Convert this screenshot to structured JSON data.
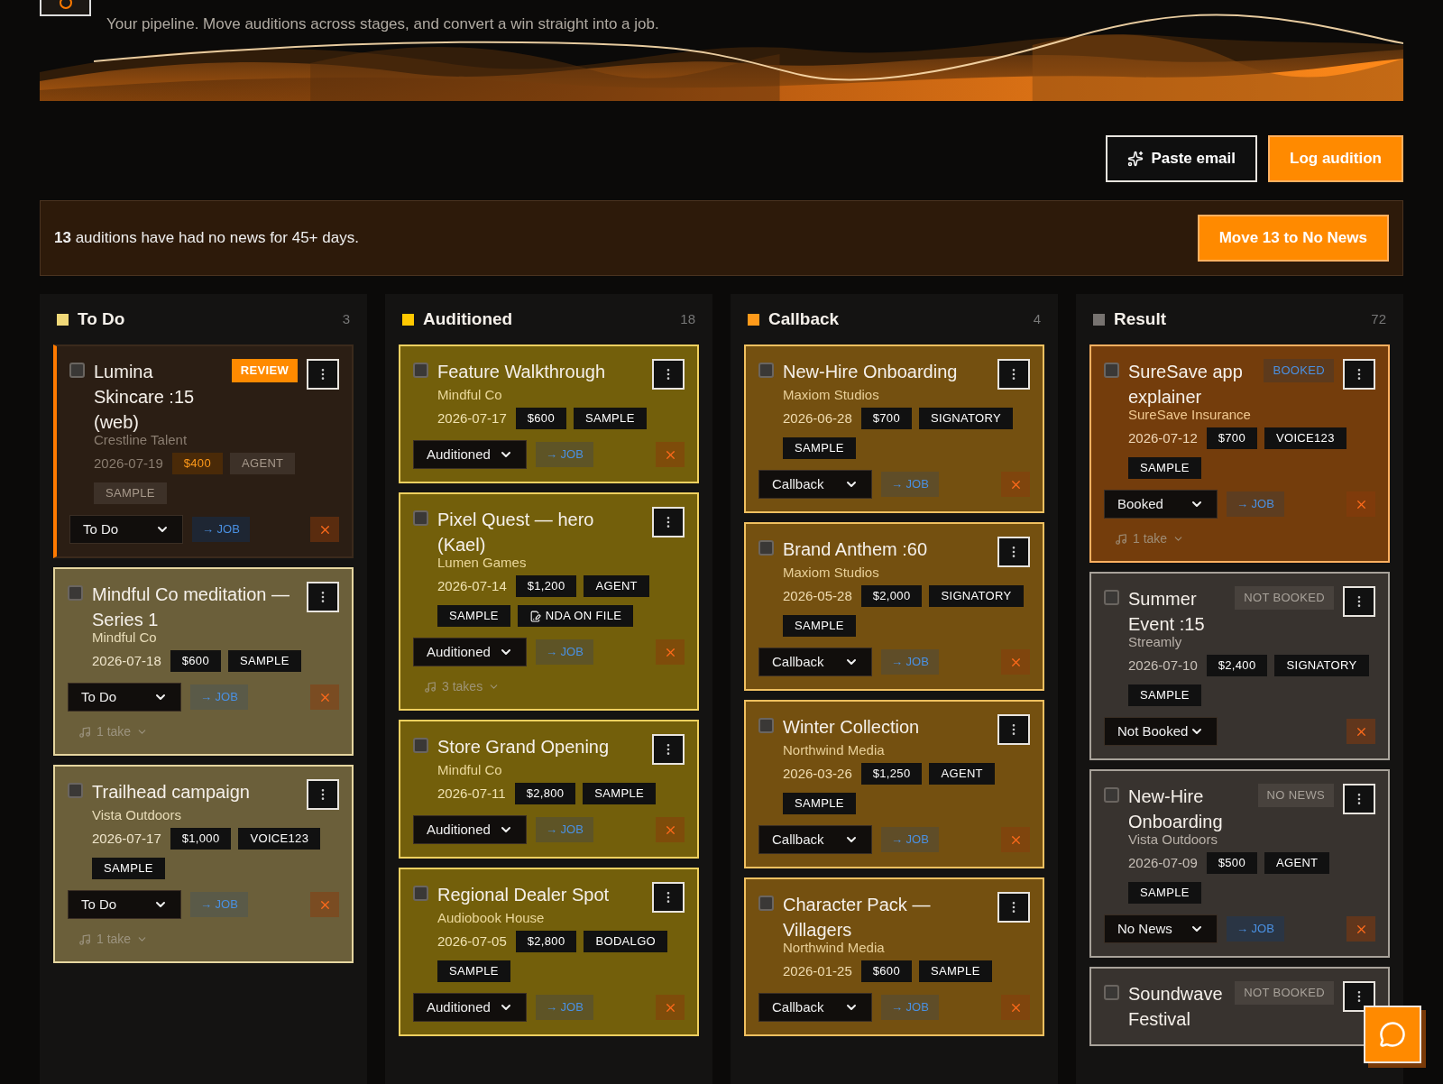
{
  "header": {
    "subtitle": "Your pipeline. Move auditions across stages, and convert a win straight into a job."
  },
  "actions": [
    {
      "label": "Paste email",
      "kind": "secondary"
    },
    {
      "label": "Log audition",
      "kind": "primary"
    }
  ],
  "alert": {
    "message": "**13** auditions have had no news for 45+ days.",
    "button": "Move 13 to No News"
  },
  "columns": [
    {
      "name": "To Do",
      "count": "3",
      "color": "#f0d878",
      "cards": [
        {
          "kind": "review",
          "checked": false,
          "title": "Lumina Skincare :15 (web)",
          "badge": {
            "label": "REVIEW",
            "kind": "review"
          },
          "client": "Crestline Talent",
          "date": "2026-07-19",
          "tags": [
            {
              "label": "$400",
              "kind": "price"
            },
            {
              "label": "AGENT",
              "kind": "plain"
            },
            {
              "label": "SAMPLE",
              "kind": "plain"
            }
          ],
          "stage": "To Do",
          "job": "→ JOB"
        },
        {
          "kind": "todo",
          "checked": false,
          "title": "Mindful Co meditation — Series 1",
          "client": "Mindful Co",
          "date": "2026-07-18",
          "tags": [
            {
              "label": "$600",
              "kind": "price"
            },
            {
              "label": "SAMPLE",
              "kind": "plain"
            }
          ],
          "stage": "To Do",
          "job": "→ JOB",
          "takes": "1 take"
        },
        {
          "kind": "todo",
          "checked": false,
          "title": "Trailhead campaign",
          "client": "Vista Outdoors",
          "date": "2026-07-17",
          "tags": [
            {
              "label": "$1,000",
              "kind": "price"
            },
            {
              "label": "VOICE123",
              "kind": "plain"
            },
            {
              "label": "SAMPLE",
              "kind": "plain"
            }
          ],
          "stage": "To Do",
          "job": "→ JOB",
          "takes": "1 take"
        }
      ]
    },
    {
      "name": "Auditioned",
      "count": "18",
      "color": "#ffc800",
      "cards": [
        {
          "kind": "auditioned",
          "checked": false,
          "title": "Feature Walkthrough",
          "client": "Mindful Co",
          "date": "2026-07-17",
          "tags": [
            {
              "label": "$600",
              "kind": "price"
            },
            {
              "label": "SAMPLE",
              "kind": "plain"
            }
          ],
          "stage": "Auditioned",
          "job": "→ JOB"
        },
        {
          "kind": "auditioned",
          "checked": false,
          "title": "Pixel Quest — hero (Kael)",
          "client": "Lumen Games",
          "date": "2026-07-14",
          "tags": [
            {
              "label": "$1,200",
              "kind": "price"
            },
            {
              "label": "AGENT",
              "kind": "plain"
            },
            {
              "label": "SAMPLE",
              "kind": "plain"
            },
            {
              "label": "NDA ON FILE",
              "kind": "document"
            }
          ],
          "stage": "Auditioned",
          "job": "→ JOB",
          "takes": "3 takes"
        },
        {
          "kind": "auditioned",
          "checked": false,
          "title": "Store Grand Opening",
          "client": "Mindful Co",
          "date": "2026-07-11",
          "tags": [
            {
              "label": "$2,800",
              "kind": "price"
            },
            {
              "label": "SAMPLE",
              "kind": "plain"
            }
          ],
          "stage": "Auditioned",
          "job": "→ JOB"
        },
        {
          "kind": "auditioned",
          "checked": false,
          "title": "Regional Dealer Spot",
          "client": "Audiobook House",
          "date": "2026-07-05",
          "tags": [
            {
              "label": "$2,800",
              "kind": "price"
            },
            {
              "label": "BODALGO",
              "kind": "plain"
            },
            {
              "label": "SAMPLE",
              "kind": "plain"
            }
          ],
          "stage": "Auditioned",
          "job": "→ JOB"
        }
      ]
    },
    {
      "name": "Callback",
      "count": "4",
      "color": "#ff9a1a",
      "cards": [
        {
          "kind": "callback",
          "checked": false,
          "title": "New-Hire Onboarding",
          "client": "Maxiom Studios",
          "date": "2026-06-28",
          "tags": [
            {
              "label": "$700",
              "kind": "price"
            },
            {
              "label": "SIGNATORY",
              "kind": "plain"
            },
            {
              "label": "SAMPLE",
              "kind": "plain"
            }
          ],
          "stage": "Callback",
          "job": "→ JOB"
        },
        {
          "kind": "callback",
          "checked": false,
          "title": "Brand Anthem :60",
          "client": "Maxiom Studios",
          "date": "2026-05-28",
          "tags": [
            {
              "label": "$2,000",
              "kind": "price"
            },
            {
              "label": "SIGNATORY",
              "kind": "plain"
            },
            {
              "label": "SAMPLE",
              "kind": "plain"
            }
          ],
          "stage": "Callback",
          "job": "→ JOB"
        },
        {
          "kind": "callback",
          "checked": false,
          "title": "Winter Collection",
          "client": "Northwind Media",
          "date": "2026-03-26",
          "tags": [
            {
              "label": "$1,250",
              "kind": "price"
            },
            {
              "label": "AGENT",
              "kind": "plain"
            },
            {
              "label": "SAMPLE",
              "kind": "plain"
            }
          ],
          "stage": "Callback",
          "job": "→ JOB"
        },
        {
          "kind": "callback",
          "checked": false,
          "title": "Character Pack — Villagers",
          "client": "Northwind Media",
          "date": "2026-01-25",
          "tags": [
            {
              "label": "$600",
              "kind": "price"
            },
            {
              "label": "SAMPLE",
              "kind": "plain"
            }
          ],
          "stage": "Callback",
          "job": "→ JOB"
        }
      ]
    },
    {
      "name": "Result",
      "count": "72",
      "color": "#777370",
      "cards": [
        {
          "kind": "booked",
          "checked": false,
          "title": "SureSave app explainer",
          "badge": {
            "label": "BOOKED",
            "kind": "booked"
          },
          "client": "SureSave Insurance",
          "date": "2026-07-12",
          "tags": [
            {
              "label": "$700",
              "kind": "price"
            },
            {
              "label": "VOICE123",
              "kind": "plain"
            },
            {
              "label": "SAMPLE",
              "kind": "plain"
            }
          ],
          "stage": "Booked",
          "job": "→ JOB",
          "takes": "1 take"
        },
        {
          "kind": "closed",
          "checked": false,
          "title": "Summer Event :15",
          "badge": {
            "label": "NOT BOOKED",
            "kind": "muted"
          },
          "client": "Streamly",
          "date": "2026-07-10",
          "tags": [
            {
              "label": "$2,400",
              "kind": "price"
            },
            {
              "label": "SIGNATORY",
              "kind": "plain"
            },
            {
              "label": "SAMPLE",
              "kind": "plain"
            }
          ],
          "stage": "Not Booked"
        },
        {
          "kind": "closed",
          "checked": false,
          "title": "New-Hire Onboarding",
          "badge": {
            "label": "NO NEWS",
            "kind": "muted"
          },
          "client": "Vista Outdoors",
          "date": "2026-07-09",
          "tags": [
            {
              "label": "$500",
              "kind": "price"
            },
            {
              "label": "AGENT",
              "kind": "plain"
            },
            {
              "label": "SAMPLE",
              "kind": "plain"
            }
          ],
          "stage": "No News",
          "job": "→ JOB"
        },
        {
          "kind": "closed",
          "checked": false,
          "title": "Soundwave Festival",
          "badge": {
            "label": "NOT BOOKED",
            "kind": "muted"
          }
        }
      ]
    }
  ]
}
